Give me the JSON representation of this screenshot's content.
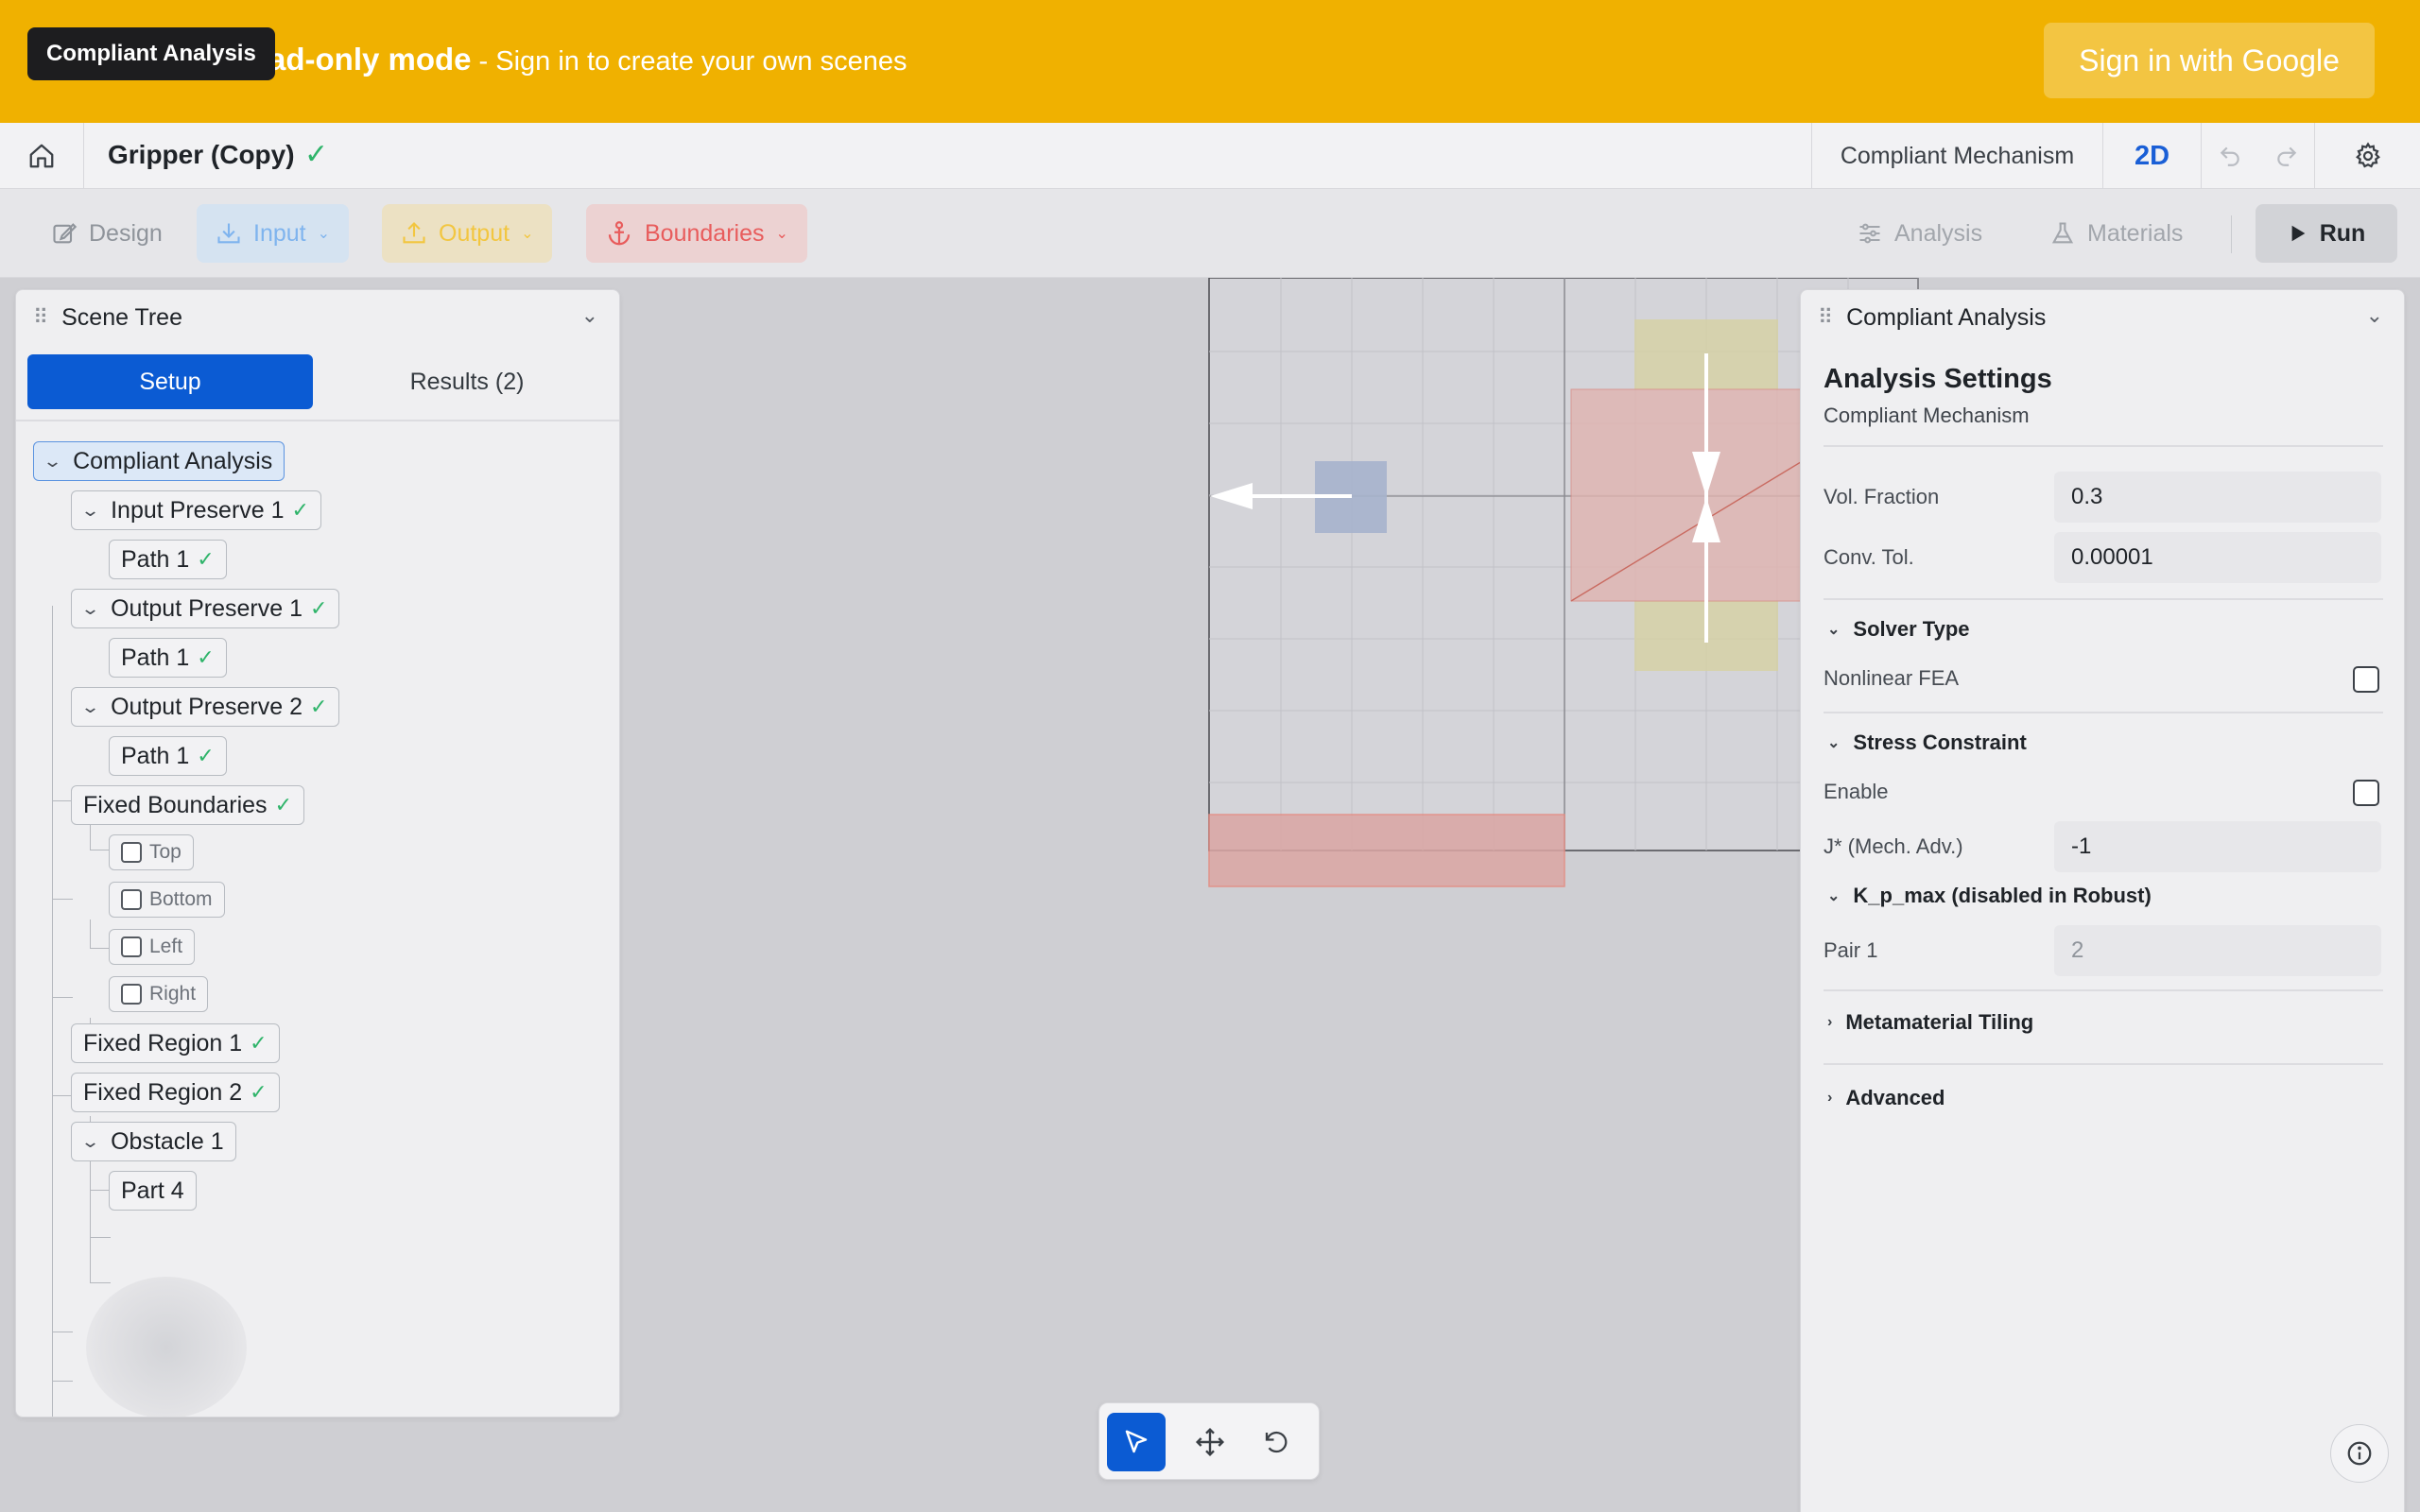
{
  "banner": {
    "text": "ad-only mode",
    "subtext": "- Sign in to create your own scenes",
    "signin_label": "Sign in with Google",
    "tooltip": "Compliant Analysis"
  },
  "topbar": {
    "title": "Gripper (Copy)",
    "mode": "Compliant Mechanism",
    "dimension": "2D"
  },
  "toolbar": {
    "design": "Design",
    "input": "Input",
    "output": "Output",
    "boundaries": "Boundaries",
    "analysis": "Analysis",
    "materials": "Materials",
    "run": "Run"
  },
  "scene_tree": {
    "title": "Scene Tree",
    "tab_setup": "Setup",
    "tab_results": "Results (2)",
    "nodes": {
      "root": "Compliant Analysis",
      "input_preserve": "Input Preserve 1",
      "input_path": "Path 1",
      "output_preserve_1": "Output Preserve 1",
      "output_path_1": "Path 1",
      "output_preserve_2": "Output Preserve 2",
      "output_path_2": "Path 1",
      "fixed_boundaries": "Fixed Boundaries",
      "top": "Top",
      "bottom": "Bottom",
      "left": "Left",
      "right": "Right",
      "fixed_region_1": "Fixed Region 1",
      "fixed_region_2": "Fixed Region 2",
      "obstacle": "Obstacle 1",
      "part": "Part 4"
    }
  },
  "analysis_panel": {
    "title": "Compliant Analysis",
    "section_title": "Analysis Settings",
    "section_sub": "Compliant Mechanism",
    "vol_fraction_label": "Vol. Fraction",
    "vol_fraction_value": "0.3",
    "conv_tol_label": "Conv. Tol.",
    "conv_tol_value": "0.00001",
    "solver_type": "Solver Type",
    "nonlinear_fea": "Nonlinear FEA",
    "stress_constraint": "Stress Constraint",
    "enable": "Enable",
    "mech_adv_label": "J* (Mech. Adv.)",
    "mech_adv_value": "-1",
    "kpmax": "K_p_max (disabled in Robust)",
    "pair1_label": "Pair 1",
    "pair1_value": "2",
    "metamaterial": "Metamaterial Tiling",
    "advanced": "Advanced"
  },
  "colors": {
    "banner": "#f0b100",
    "accent": "#0b5bd3",
    "check": "#2fb46a",
    "boundary": "#e85c5c"
  }
}
